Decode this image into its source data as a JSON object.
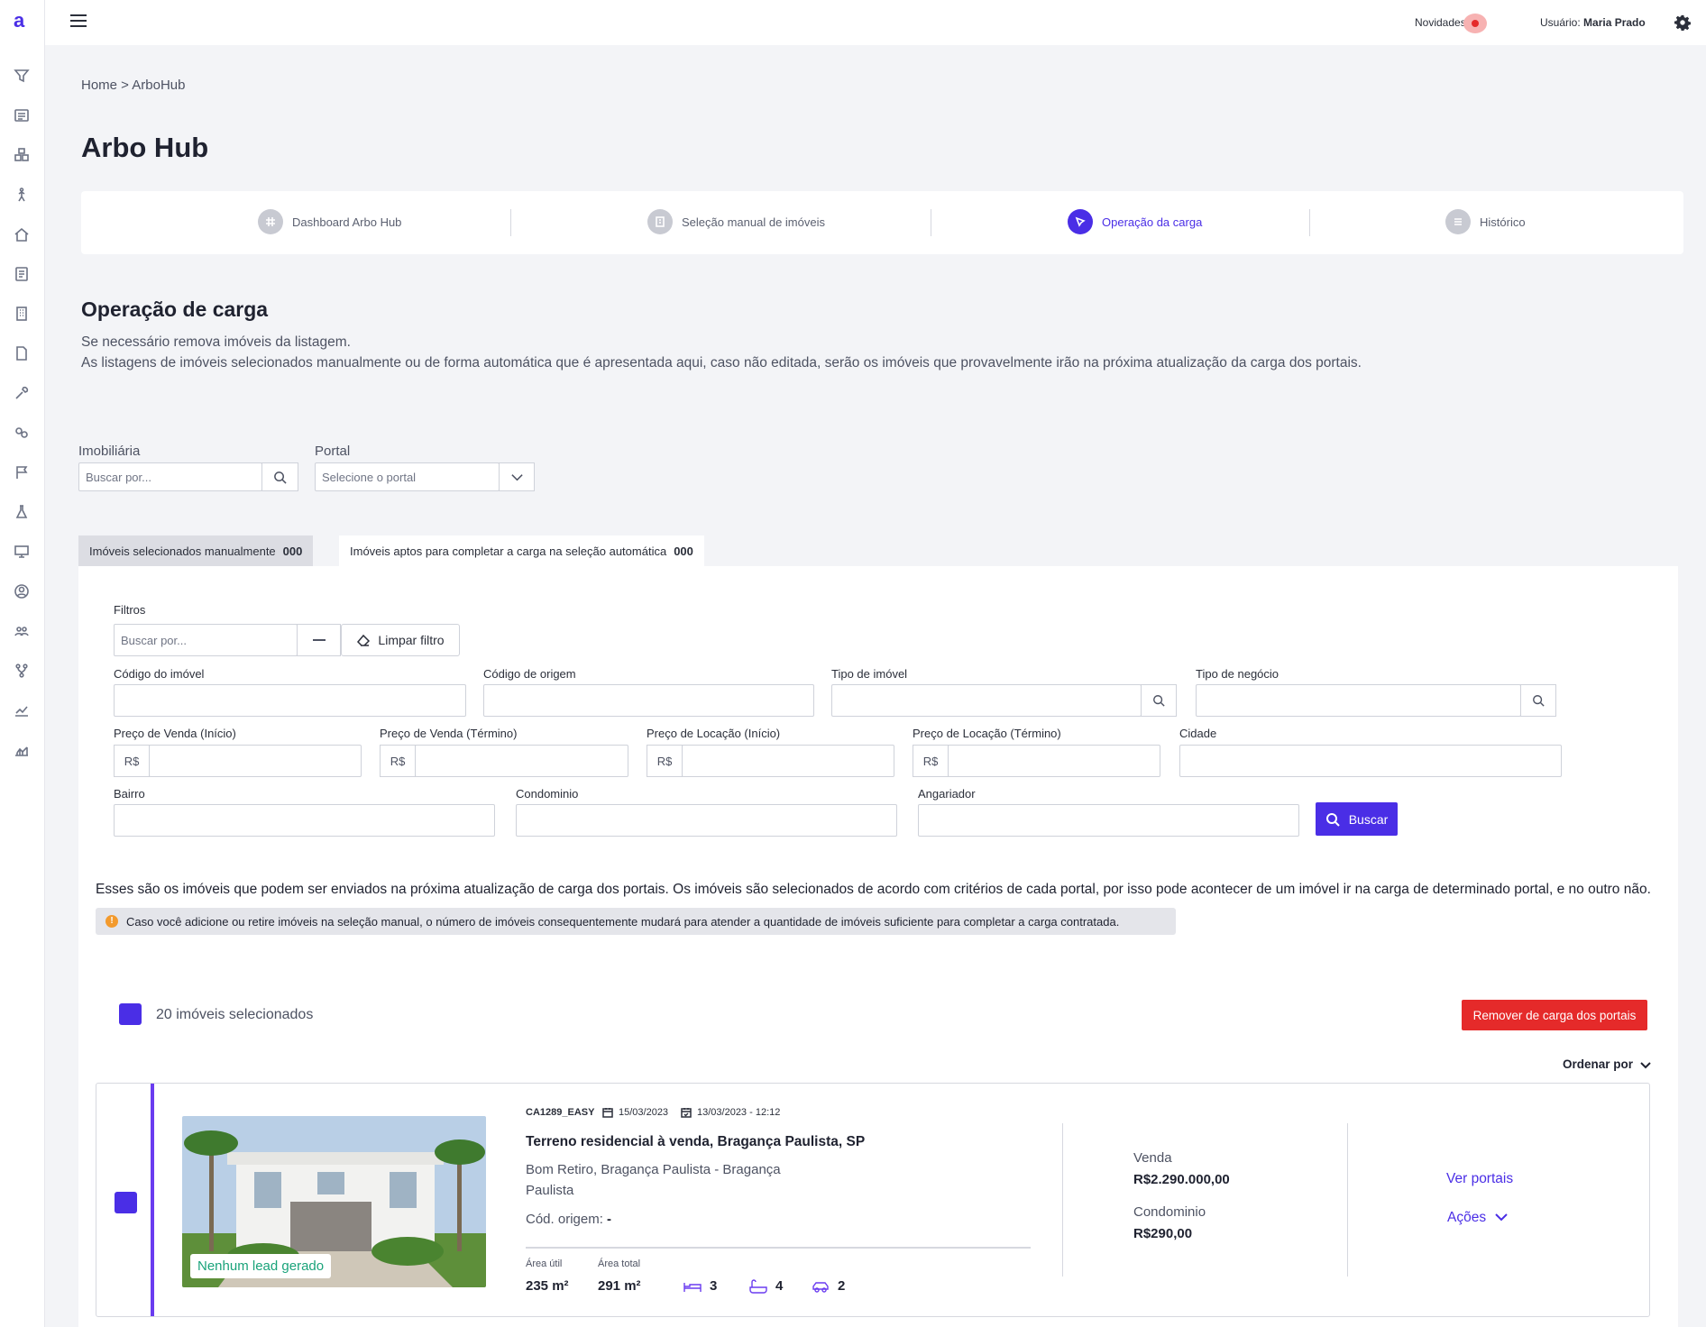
{
  "app": {
    "logo": "a"
  },
  "header": {
    "novidades_label": "Novidades",
    "user_prefix": "Usuário:",
    "user_name": "Maria Prado"
  },
  "sidebar": {
    "icons": [
      "filter-icon",
      "list-icon",
      "cubes-icon",
      "person-icon",
      "home-icon",
      "book-icon",
      "building-icon",
      "document-icon",
      "wrench-icon",
      "link-icon",
      "flag-icon",
      "flask-icon",
      "monitor-icon",
      "user-circle-icon",
      "users-icon",
      "branch-icon",
      "trend-icon",
      "stats-icon"
    ]
  },
  "breadcrumb": "Home > ArboHub",
  "page_title": "Arbo Hub",
  "steps": [
    {
      "label": "Dashboard Arbo Hub",
      "icon": "grid-icon",
      "active": false
    },
    {
      "label": "Seleção manual de imóveis",
      "icon": "building-icon",
      "active": false
    },
    {
      "label": "Operação da carga",
      "icon": "cursor-icon",
      "active": true
    },
    {
      "label": "Histórico",
      "icon": "list-icon",
      "active": false
    }
  ],
  "section": {
    "title": "Operação de carga",
    "desc1": "Se necessário remova imóveis da listagem.",
    "desc2": "As listagens de imóveis selecionados manualmente ou de forma automática que é apresentada aqui, caso não editada, serão os imóveis que provavelmente irão na próxima atualização da carga dos portais."
  },
  "top_filters": {
    "imobiliaria_label": "Imobiliária",
    "imobiliaria_placeholder": "Buscar por...",
    "portal_label": "Portal",
    "portal_placeholder": "Selecione o portal"
  },
  "tabs": [
    {
      "label": "Imóveis selecionados manualmente",
      "count": "000"
    },
    {
      "label": "Imóveis aptos para completar a carga na seleção automática",
      "count": "000"
    }
  ],
  "filters": {
    "title": "Filtros",
    "search_placeholder": "Buscar por...",
    "clear_label": "Limpar filtro",
    "codigo_imovel": "Código do imóvel",
    "codigo_origem": "Código de origem",
    "tipo_imovel": "Tipo de imóvel",
    "tipo_negocio": "Tipo de negócio",
    "preco_venda_inicio": "Preço de Venda (Início)",
    "preco_venda_termino": "Preço de Venda (Término)",
    "preco_locacao_inicio": "Preço de Locação (Início)",
    "preco_locacao_termino": "Preço de Locação (Término)",
    "cidade": "Cidade",
    "bairro": "Bairro",
    "condominio": "Condominio",
    "angariador": "Angariador",
    "currency": "R$",
    "search_button": "Buscar"
  },
  "info": {
    "text": "Esses são os imóveis que podem ser enviados na próxima atualização de carga dos portais. Os imóveis são selecionados de acordo com critérios de cada portal, por isso pode acontecer de um imóvel ir na carga de determinado portal, e no outro não.",
    "alert": "Caso você adicione ou retire imóveis na seleção manual, o número de imóveis consequentemente mudará para atender a quantidade de imóveis suficiente para completar a carga contratada."
  },
  "selection": {
    "count_label": "20 imóveis selecionados",
    "remove_button": "Remover de carga dos portais",
    "sort_label": "Ordenar por"
  },
  "property": {
    "code": "CA1289_EASY",
    "date1": "15/03/2023",
    "date2": "13/03/2023 - 12:12",
    "title": "Terreno residencial à venda, Bragança Paulista, SP",
    "address": "Bom Retiro, Bragança Paulista - Bragança Paulista",
    "origin_label": "Cód. origem:",
    "origin_value": "-",
    "lead_badge": "Nenhum lead gerado",
    "area_util_label": "Área útil",
    "area_util_value": "235 m²",
    "area_total_label": "Área total",
    "area_total_value": "291 m²",
    "bedrooms": "3",
    "bathrooms": "4",
    "parking": "2",
    "venda_label": "Venda",
    "venda_value": "R$2.290.000,00",
    "condominio_label": "Condominio",
    "condominio_value": "R$290,00",
    "ver_portais": "Ver portais",
    "acoes": "Ações"
  },
  "colors": {
    "accent": "#4a2ee6",
    "danger": "#e52a2a",
    "success": "#1aa37a"
  }
}
